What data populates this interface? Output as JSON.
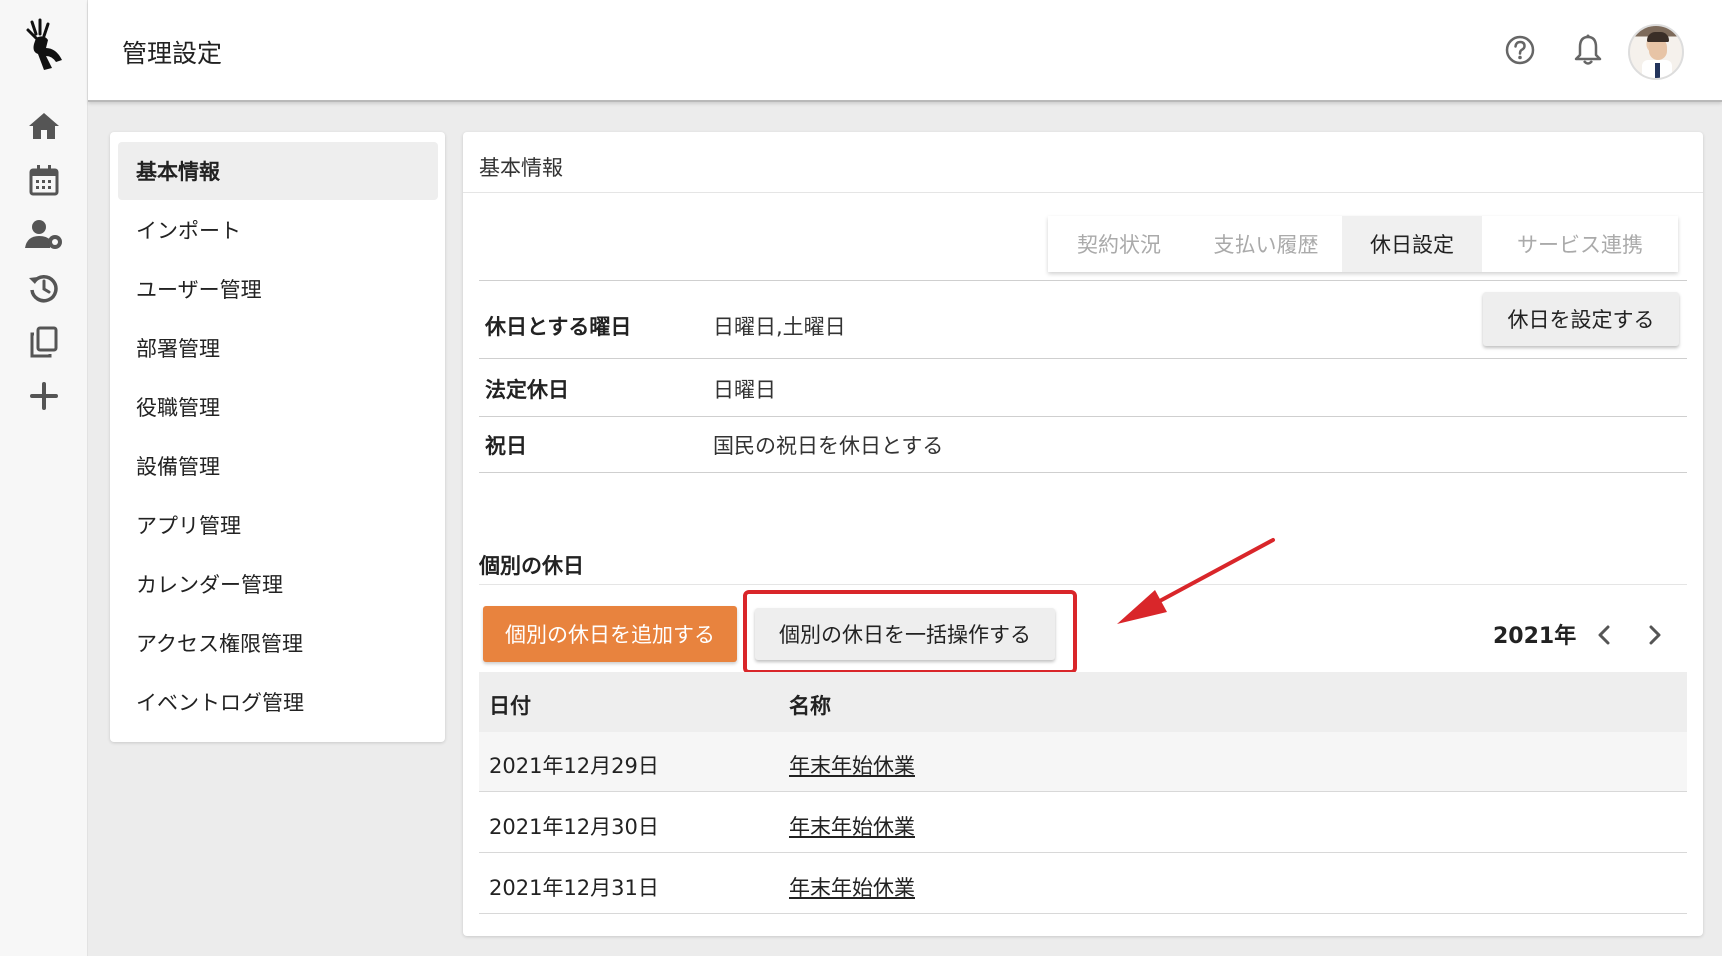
{
  "header": {
    "title": "管理設定"
  },
  "sidebar": {
    "items": [
      {
        "label": "基本情報",
        "active": true
      },
      {
        "label": "インポート"
      },
      {
        "label": "ユーザー管理"
      },
      {
        "label": "部署管理"
      },
      {
        "label": "役職管理"
      },
      {
        "label": "設備管理"
      },
      {
        "label": "アプリ管理"
      },
      {
        "label": "カレンダー管理"
      },
      {
        "label": "アクセス権限管理"
      },
      {
        "label": "イベントログ管理"
      }
    ]
  },
  "rail_icons": [
    "home-icon",
    "calendar-icon",
    "user-settings-icon",
    "history-icon",
    "copy-icon",
    "plus-icon"
  ],
  "header_icons": [
    "help-icon",
    "bell-icon"
  ],
  "main": {
    "card_title": "基本情報",
    "tabs": [
      {
        "label": "契約状況"
      },
      {
        "label": "支払い履歴"
      },
      {
        "label": "休日設定",
        "active": true
      },
      {
        "label": "サービス連携"
      }
    ],
    "settings": [
      {
        "label": "休日とする曜日",
        "value": "日曜日,土曜日"
      },
      {
        "label": "法定休日",
        "value": "日曜日"
      },
      {
        "label": "祝日",
        "value": "国民の祝日を休日とする"
      }
    ],
    "set_button": "休日を設定する",
    "section_title": "個別の休日",
    "add_button": "個別の休日を追加する",
    "bulk_button": "個別の休日を一括操作する",
    "year": "2021年",
    "table": {
      "headers": [
        "日付",
        "名称"
      ],
      "rows": [
        {
          "date": "2021年12月29日",
          "name": "年末年始休業"
        },
        {
          "date": "2021年12月30日",
          "name": "年末年始休業"
        },
        {
          "date": "2021年12月31日",
          "name": "年末年始休業"
        }
      ]
    }
  },
  "colors": {
    "accent": "#e8833e",
    "highlight": "#d9262a"
  }
}
